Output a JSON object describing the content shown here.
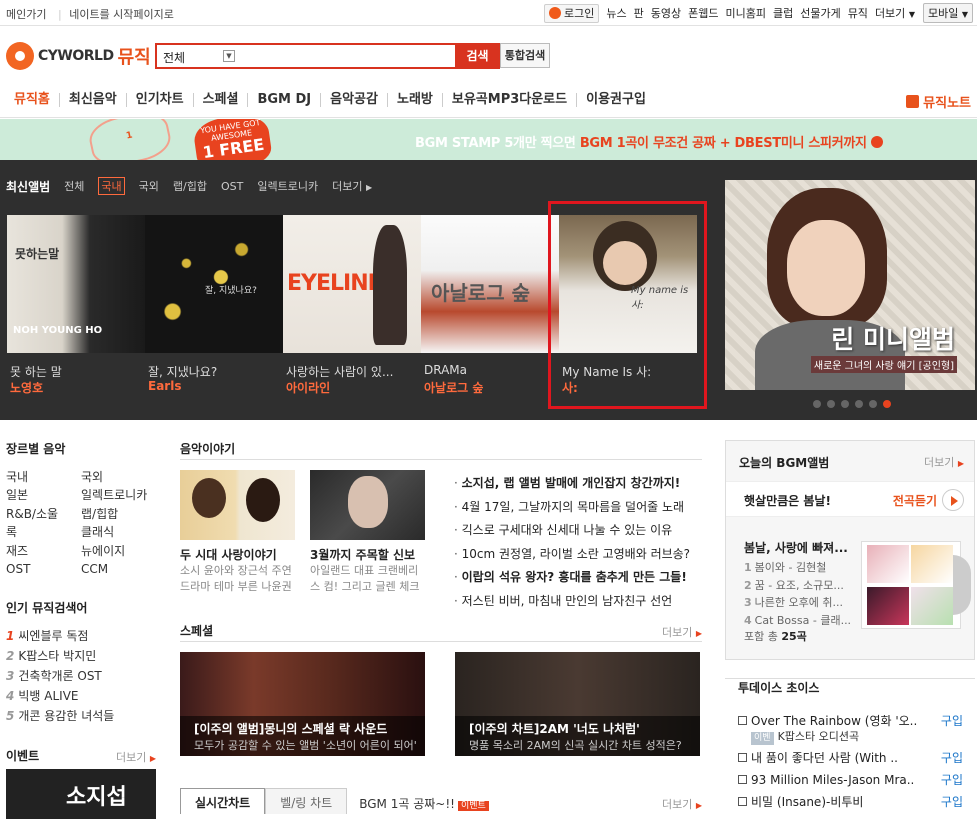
{
  "topbar": {
    "left_links": [
      "메인가기",
      "네이트를 시작페이지로"
    ],
    "login": "로그인",
    "right_links": [
      "뉴스",
      "판",
      "동영상",
      "폰웹드",
      "미니홈피",
      "클럽",
      "선물가게",
      "뮤직",
      "더보기"
    ],
    "mobile": "모바일"
  },
  "logo": {
    "brand": "CYWORLD",
    "music": "뮤직"
  },
  "search": {
    "category": "전체",
    "submit": "검색",
    "integrated": "통합검색"
  },
  "gnb": {
    "items": [
      "뮤직홈",
      "최신음악",
      "인기차트",
      "스페셜",
      "BGM DJ",
      "음악공감",
      "노래방",
      "보유곡MP3다운로드",
      "이용권구입"
    ],
    "note": "뮤직노트"
  },
  "banner": {
    "stamp_text": "1",
    "badge_small": "YOU HAVE GOT AWESOME",
    "badge_big": "1 FREE",
    "text_a": "BGM STAMP 5개만 찍으면 ",
    "text_b": "BGM 1곡이 무조건 공짜 + DBEST미니 스피커까지"
  },
  "new_albums": {
    "title": "최신앨범",
    "filters": [
      "전체",
      "국내",
      "국외",
      "랩/힙합",
      "OST",
      "일렉트로니카"
    ],
    "more": "더보기",
    "albums": [
      {
        "title": "못 하는 말",
        "artist": "노영호",
        "cover_text": "NOH YOUNG HO",
        "cover_text2": "못하는말"
      },
      {
        "title": "잘, 지냈나요?",
        "artist": "Earls",
        "cover_text": "잘, 지냈나요?"
      },
      {
        "title": "사랑하는 사람이 있...",
        "artist": "아이라인",
        "cover_text": "EYELINE"
      },
      {
        "title": "DRAMa",
        "artist": "아날로그 숲",
        "cover_text": "아날로그 숲"
      },
      {
        "title": "My Name Is 사:",
        "artist": "사:",
        "cover_text": "My name is 사:"
      }
    ],
    "feature": {
      "title": "린 미니앨범",
      "sub": "새로운 그녀의 사랑 얘기 [공인형]"
    }
  },
  "genre": {
    "title": "장르별 음악",
    "items": [
      "국내",
      "국외",
      "일본",
      "일렉트로니카",
      "R&B/소울",
      "랩/힙합",
      "록",
      "클래식",
      "재즈",
      "뉴에이지",
      "OST",
      "CCM"
    ]
  },
  "keywords": {
    "title": "인기 뮤직검색어",
    "items": [
      "씨엔블루 독점",
      "K팝스타 박지민",
      "건축학개론 OST",
      "빅뱅 ALIVE",
      "개콘 용감한 녀석들"
    ]
  },
  "event": {
    "title": "이벤트",
    "more": "더보기",
    "img_text": "소지섭"
  },
  "story": {
    "title": "음악이야기",
    "cards": [
      {
        "title": "두 시대 사랑이야기",
        "desc1": "소시 윤아와 장근석 주연",
        "desc2": "드라마 테마 부른 나윤권"
      },
      {
        "title": "3월까지 주목할 신보",
        "desc1": "아일랜드 대표 크랜베리",
        "desc2": "스 컴! 그리고 글렌 체크"
      }
    ],
    "list": [
      "소지섭, 랩 앨범 발매에 개인잡지 창간까지!",
      "4월 17일, 그날까지의 목마름을 덜어줄 노래",
      "긱스로 구세대와 신세대 나눌 수 있는 이유",
      "10cm 권정열, 라이벌 소란 고영배와 러브송?",
      "이랍의 석유 왕자? 흥대를 춤추게 만든 그들!",
      "저스틴 비버, 마침내 만인의 남자친구 선언"
    ]
  },
  "special": {
    "title": "스페셜",
    "more": "더보기",
    "items": [
      {
        "cap1": "[이주의 앨범]몽니의 스페셜 락 사운드",
        "cap2": "모두가 공감할 수 있는 앨범 '소년이 어른이 되어'"
      },
      {
        "cap1": "[이주의 차트]2AM '너도 나처럼'",
        "cap2": "명품 목소리 2AM의 신곡 실시간 차트 성적은?"
      }
    ]
  },
  "chart_tabs": {
    "tabs": [
      "실시간차트",
      "벨/링 차트"
    ],
    "extra": "BGM 1곡 공짜~!!",
    "badge": "이벤트",
    "more": "더보기"
  },
  "bgm_album": {
    "title": "오늘의 BGM앨범",
    "more": "더보기",
    "headline": "햇살만큼은 봄날!",
    "play": "전곡듣기",
    "album_title": "봄날, 사랑에 빠져...",
    "tracks": [
      "봄이와 - 김현철",
      "꿈 - 요조, 소규모...",
      "나른한 오후에 취...",
      "Cat Bossa - 클래..."
    ],
    "count_prefix": "포함 총 ",
    "count": "25곡"
  },
  "choice": {
    "title": "투데이스 초이스",
    "items": [
      {
        "title": "Over The Rainbow (영화 '오..",
        "buy": "구입",
        "tag": "이벤",
        "sub": "K팝스타 오디션곡"
      },
      {
        "title": "내 품이 좋다던 사람 (With ..",
        "buy": "구입"
      },
      {
        "title": "93 Million Miles-Jason Mra..",
        "buy": "구입"
      },
      {
        "title": "비밀 (Insane)-비투비",
        "buy": "구입"
      }
    ]
  },
  "colors": {
    "accent": "#e8521c",
    "red": "#d8331f",
    "highlight_border": "#e0161e"
  }
}
